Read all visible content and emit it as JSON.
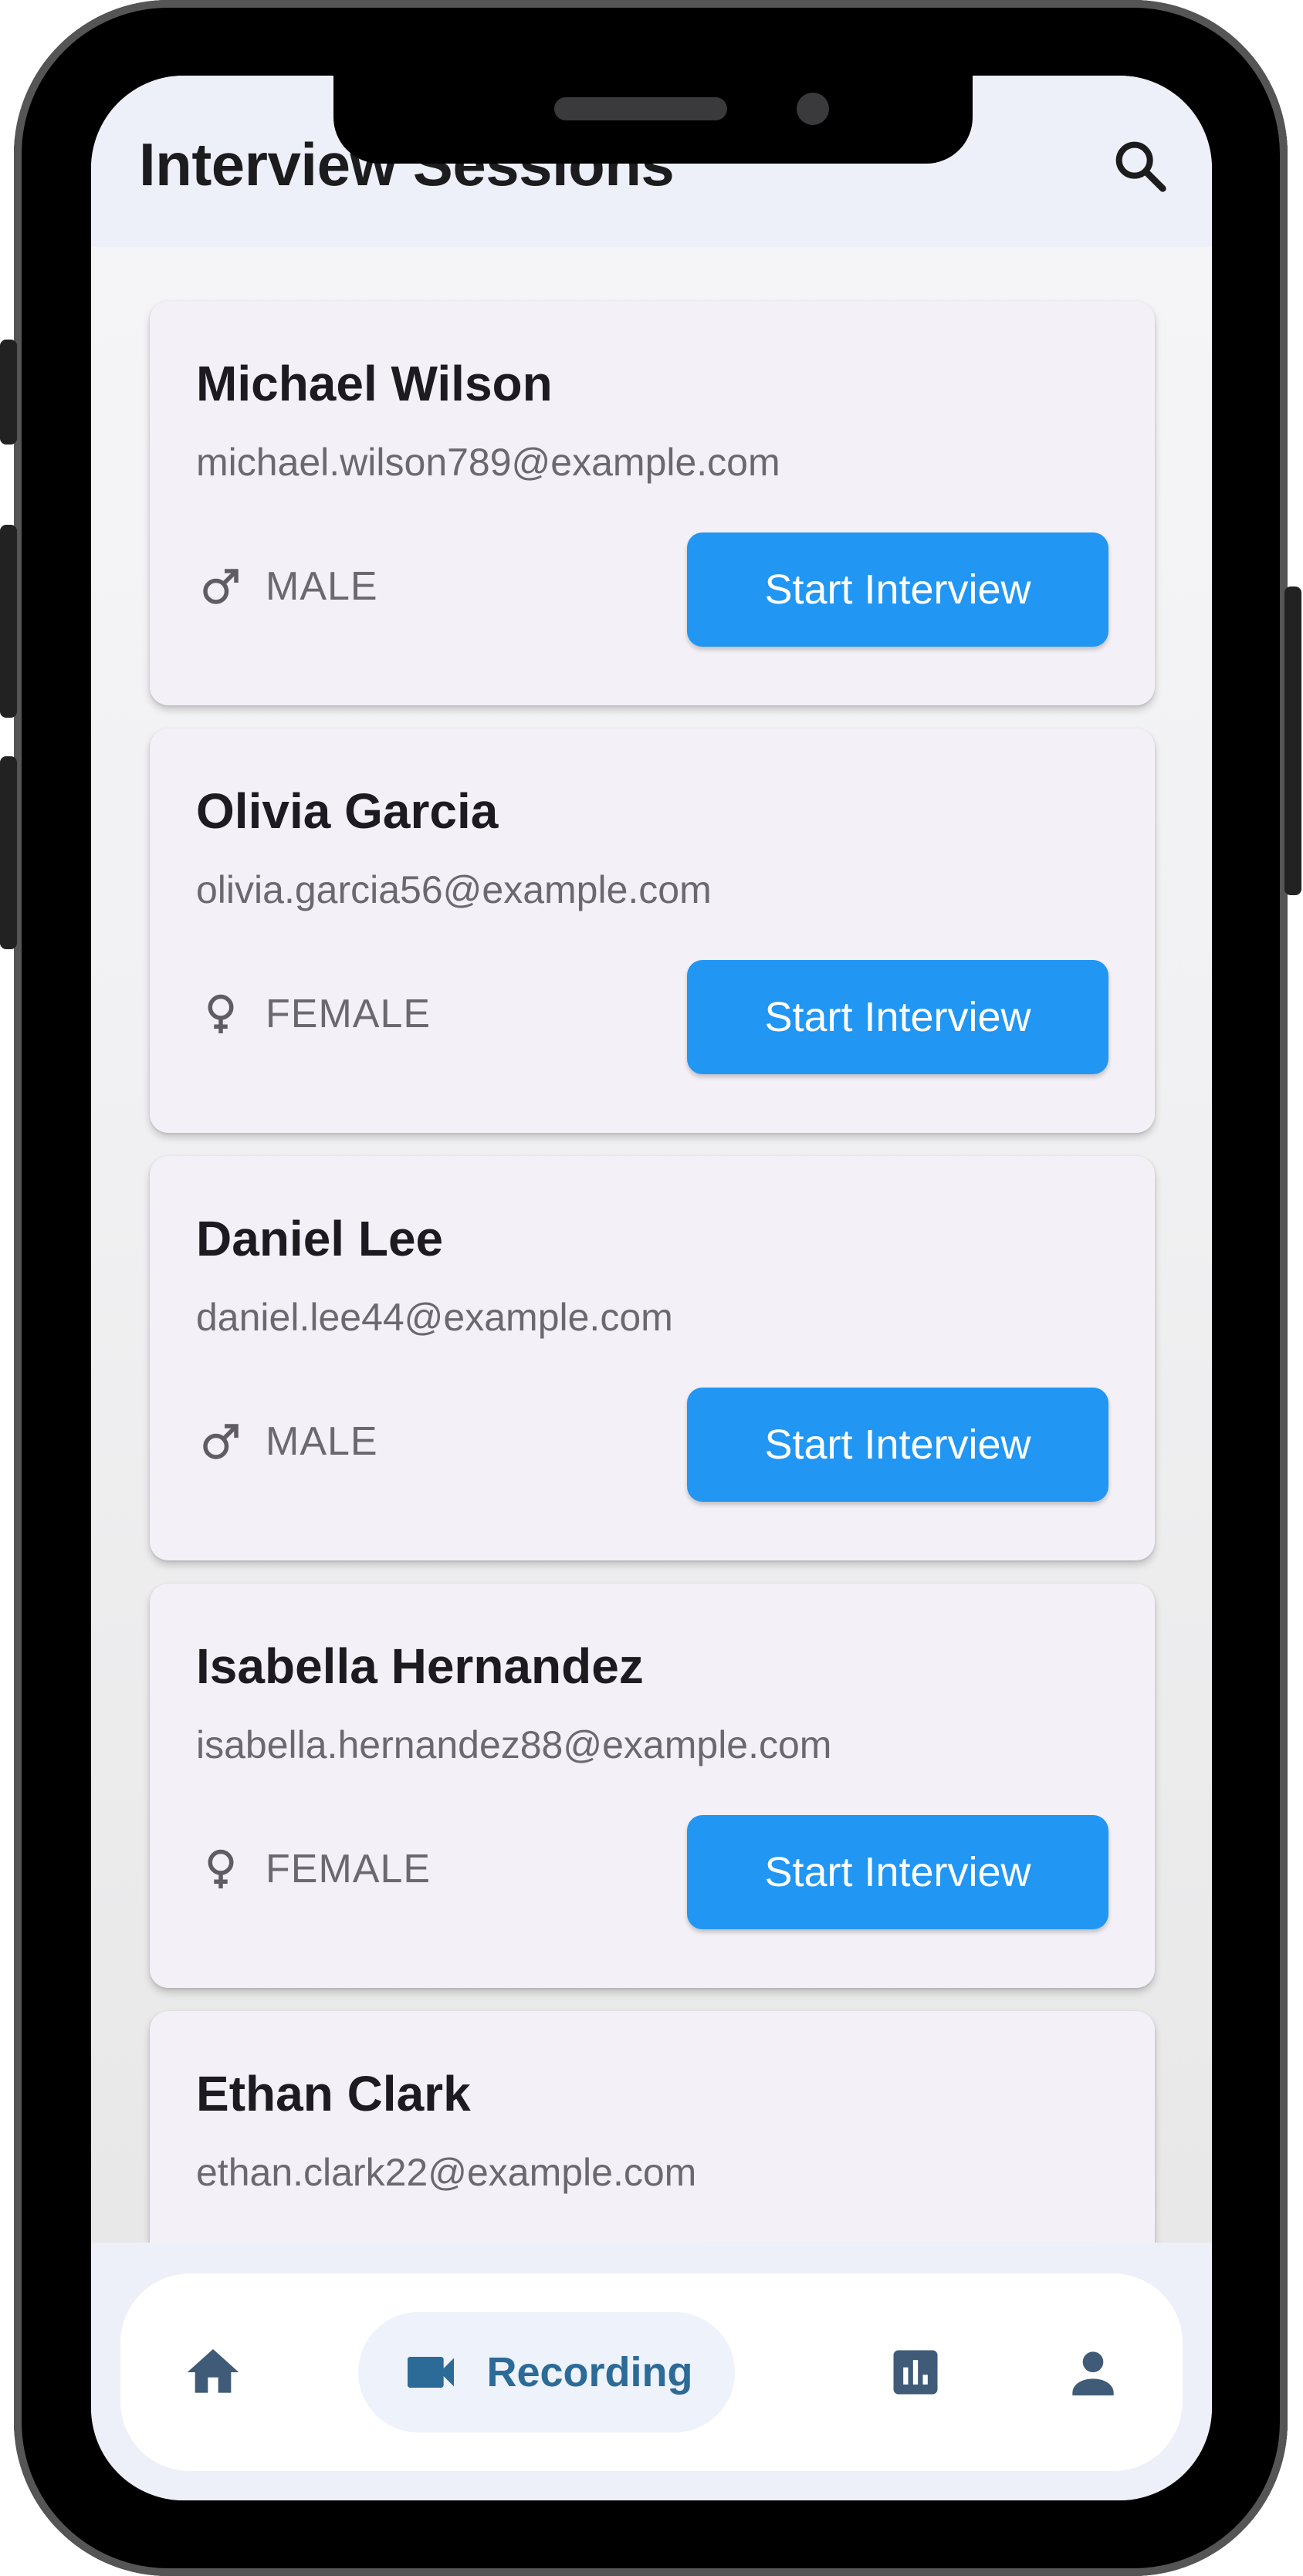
{
  "header": {
    "title": "Interview Sessions"
  },
  "icons": {
    "search": "search-icon",
    "male": "male-icon",
    "female": "female-icon",
    "home": "home-icon",
    "recording": "videocam-icon",
    "stats": "bar-chart-icon",
    "profile": "person-icon"
  },
  "candidates": [
    {
      "name": "Michael Wilson",
      "email": "michael.wilson789@example.com",
      "gender": "MALE",
      "action": "Start Interview"
    },
    {
      "name": "Olivia Garcia",
      "email": "olivia.garcia56@example.com",
      "gender": "FEMALE",
      "action": "Start Interview"
    },
    {
      "name": "Daniel Lee",
      "email": "daniel.lee44@example.com",
      "gender": "MALE",
      "action": "Start Interview"
    },
    {
      "name": "Isabella Hernandez",
      "email": "isabella.hernandez88@example.com",
      "gender": "FEMALE",
      "action": "Start Interview"
    },
    {
      "name": "Ethan Clark",
      "email": "ethan.clark22@example.com",
      "gender": "",
      "action": ""
    }
  ],
  "nav": {
    "recording_label": "Recording",
    "active": "Recording"
  },
  "colors": {
    "primary_button": "#2196f3",
    "card_background": "#f4f0f7",
    "nav_active": "#2c6a97",
    "nav_active_bg": "#edf2fb",
    "nav_icon": "#3f5b78"
  }
}
